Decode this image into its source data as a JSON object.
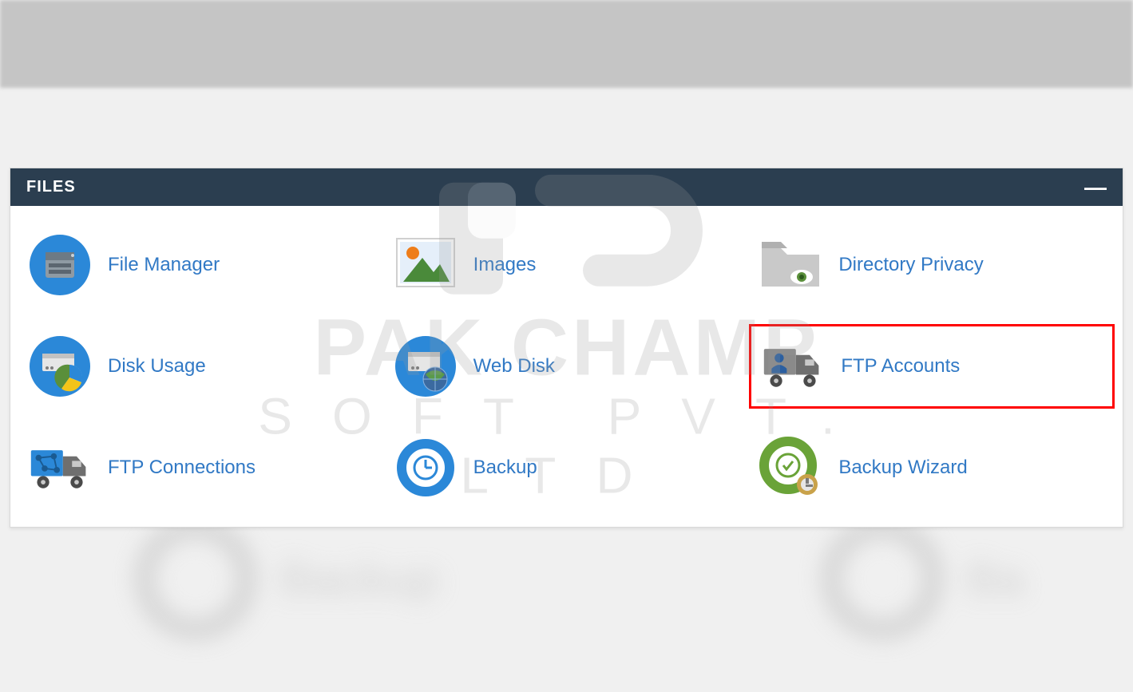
{
  "panel": {
    "title": "FILES",
    "collapse_symbol": "—",
    "items": [
      {
        "label": "File Manager",
        "icon": "file-manager-icon",
        "highlighted": false
      },
      {
        "label": "Images",
        "icon": "images-icon",
        "highlighted": false
      },
      {
        "label": "Directory Privacy",
        "icon": "directory-privacy-icon",
        "highlighted": false
      },
      {
        "label": "Disk Usage",
        "icon": "disk-usage-icon",
        "highlighted": false
      },
      {
        "label": "Web Disk",
        "icon": "web-disk-icon",
        "highlighted": false
      },
      {
        "label": "FTP Accounts",
        "icon": "ftp-accounts-icon",
        "highlighted": true
      },
      {
        "label": "FTP Connections",
        "icon": "ftp-connections-icon",
        "highlighted": false
      },
      {
        "label": "Backup",
        "icon": "backup-icon",
        "highlighted": false
      },
      {
        "label": "Backup Wizard",
        "icon": "backup-wizard-icon",
        "highlighted": false
      }
    ]
  },
  "watermark": {
    "line1": "PAK CHAMP",
    "line2": "SOFT PVT. LTD"
  },
  "ghost_left_label": "Backup",
  "ghost_right_label": "Ba",
  "colors": {
    "header_bg": "#2b3e50",
    "link": "#3179c5",
    "highlight_border": "#ff0000"
  }
}
